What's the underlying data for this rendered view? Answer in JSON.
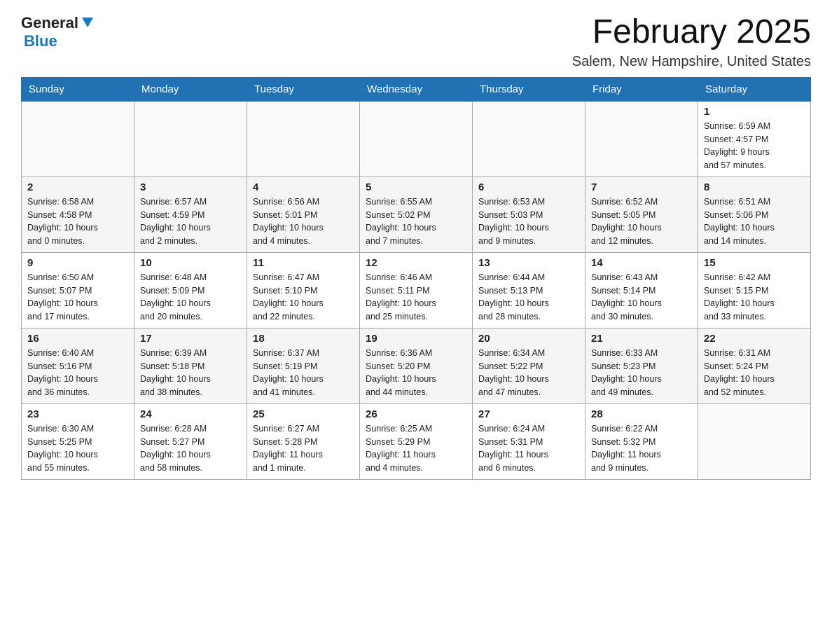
{
  "header": {
    "logo_general": "General",
    "logo_blue": "Blue",
    "month_title": "February 2025",
    "location": "Salem, New Hampshire, United States"
  },
  "weekdays": [
    "Sunday",
    "Monday",
    "Tuesday",
    "Wednesday",
    "Thursday",
    "Friday",
    "Saturday"
  ],
  "weeks": [
    [
      {
        "day": "",
        "info": ""
      },
      {
        "day": "",
        "info": ""
      },
      {
        "day": "",
        "info": ""
      },
      {
        "day": "",
        "info": ""
      },
      {
        "day": "",
        "info": ""
      },
      {
        "day": "",
        "info": ""
      },
      {
        "day": "1",
        "info": "Sunrise: 6:59 AM\nSunset: 4:57 PM\nDaylight: 9 hours\nand 57 minutes."
      }
    ],
    [
      {
        "day": "2",
        "info": "Sunrise: 6:58 AM\nSunset: 4:58 PM\nDaylight: 10 hours\nand 0 minutes."
      },
      {
        "day": "3",
        "info": "Sunrise: 6:57 AM\nSunset: 4:59 PM\nDaylight: 10 hours\nand 2 minutes."
      },
      {
        "day": "4",
        "info": "Sunrise: 6:56 AM\nSunset: 5:01 PM\nDaylight: 10 hours\nand 4 minutes."
      },
      {
        "day": "5",
        "info": "Sunrise: 6:55 AM\nSunset: 5:02 PM\nDaylight: 10 hours\nand 7 minutes."
      },
      {
        "day": "6",
        "info": "Sunrise: 6:53 AM\nSunset: 5:03 PM\nDaylight: 10 hours\nand 9 minutes."
      },
      {
        "day": "7",
        "info": "Sunrise: 6:52 AM\nSunset: 5:05 PM\nDaylight: 10 hours\nand 12 minutes."
      },
      {
        "day": "8",
        "info": "Sunrise: 6:51 AM\nSunset: 5:06 PM\nDaylight: 10 hours\nand 14 minutes."
      }
    ],
    [
      {
        "day": "9",
        "info": "Sunrise: 6:50 AM\nSunset: 5:07 PM\nDaylight: 10 hours\nand 17 minutes."
      },
      {
        "day": "10",
        "info": "Sunrise: 6:48 AM\nSunset: 5:09 PM\nDaylight: 10 hours\nand 20 minutes."
      },
      {
        "day": "11",
        "info": "Sunrise: 6:47 AM\nSunset: 5:10 PM\nDaylight: 10 hours\nand 22 minutes."
      },
      {
        "day": "12",
        "info": "Sunrise: 6:46 AM\nSunset: 5:11 PM\nDaylight: 10 hours\nand 25 minutes."
      },
      {
        "day": "13",
        "info": "Sunrise: 6:44 AM\nSunset: 5:13 PM\nDaylight: 10 hours\nand 28 minutes."
      },
      {
        "day": "14",
        "info": "Sunrise: 6:43 AM\nSunset: 5:14 PM\nDaylight: 10 hours\nand 30 minutes."
      },
      {
        "day": "15",
        "info": "Sunrise: 6:42 AM\nSunset: 5:15 PM\nDaylight: 10 hours\nand 33 minutes."
      }
    ],
    [
      {
        "day": "16",
        "info": "Sunrise: 6:40 AM\nSunset: 5:16 PM\nDaylight: 10 hours\nand 36 minutes."
      },
      {
        "day": "17",
        "info": "Sunrise: 6:39 AM\nSunset: 5:18 PM\nDaylight: 10 hours\nand 38 minutes."
      },
      {
        "day": "18",
        "info": "Sunrise: 6:37 AM\nSunset: 5:19 PM\nDaylight: 10 hours\nand 41 minutes."
      },
      {
        "day": "19",
        "info": "Sunrise: 6:36 AM\nSunset: 5:20 PM\nDaylight: 10 hours\nand 44 minutes."
      },
      {
        "day": "20",
        "info": "Sunrise: 6:34 AM\nSunset: 5:22 PM\nDaylight: 10 hours\nand 47 minutes."
      },
      {
        "day": "21",
        "info": "Sunrise: 6:33 AM\nSunset: 5:23 PM\nDaylight: 10 hours\nand 49 minutes."
      },
      {
        "day": "22",
        "info": "Sunrise: 6:31 AM\nSunset: 5:24 PM\nDaylight: 10 hours\nand 52 minutes."
      }
    ],
    [
      {
        "day": "23",
        "info": "Sunrise: 6:30 AM\nSunset: 5:25 PM\nDaylight: 10 hours\nand 55 minutes."
      },
      {
        "day": "24",
        "info": "Sunrise: 6:28 AM\nSunset: 5:27 PM\nDaylight: 10 hours\nand 58 minutes."
      },
      {
        "day": "25",
        "info": "Sunrise: 6:27 AM\nSunset: 5:28 PM\nDaylight: 11 hours\nand 1 minute."
      },
      {
        "day": "26",
        "info": "Sunrise: 6:25 AM\nSunset: 5:29 PM\nDaylight: 11 hours\nand 4 minutes."
      },
      {
        "day": "27",
        "info": "Sunrise: 6:24 AM\nSunset: 5:31 PM\nDaylight: 11 hours\nand 6 minutes."
      },
      {
        "day": "28",
        "info": "Sunrise: 6:22 AM\nSunset: 5:32 PM\nDaylight: 11 hours\nand 9 minutes."
      },
      {
        "day": "",
        "info": ""
      }
    ]
  ]
}
